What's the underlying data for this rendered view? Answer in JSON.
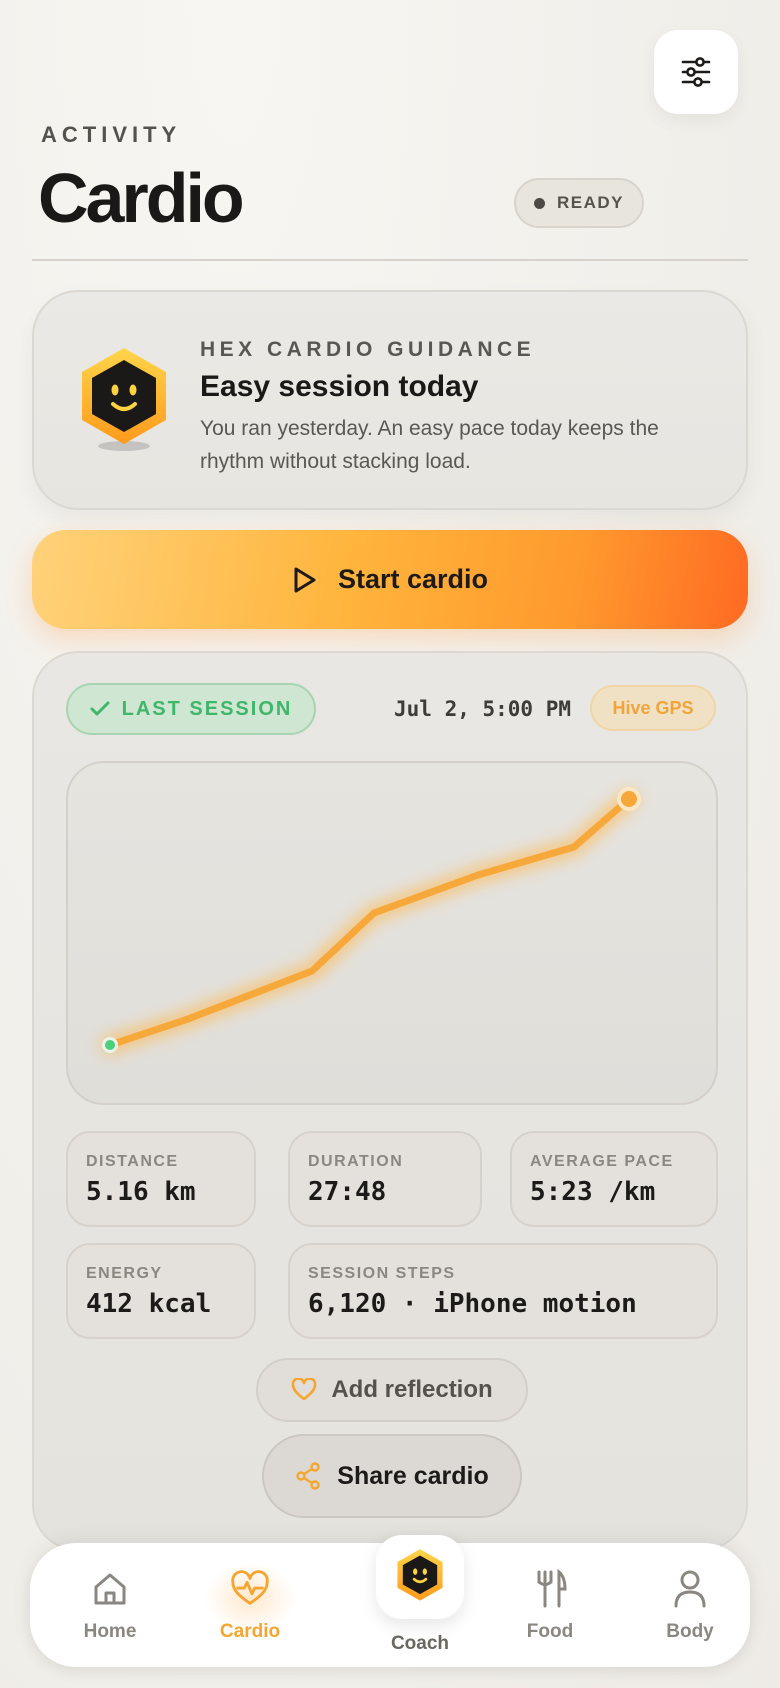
{
  "header": {
    "eyebrow": "ACTIVITY",
    "title": "Cardio",
    "status": "READY",
    "settings_icon": "sliders-icon"
  },
  "guidance": {
    "eyebrow": "HEX CARDIO GUIDANCE",
    "title": "Easy session today",
    "body": "You ran yesterday. An easy pace today keeps the rhythm without stacking load."
  },
  "start_button": {
    "label": "Start cardio",
    "icon": "play-icon"
  },
  "last_session": {
    "badge": "LAST SESSION",
    "date": "Jul 2, 5:00 PM",
    "source": "Hive GPS",
    "stats": {
      "distance": {
        "label": "DISTANCE",
        "value": "5.16 km"
      },
      "duration": {
        "label": "DURATION",
        "value": "27:48"
      },
      "pace": {
        "label": "AVERAGE PACE",
        "value": "5:23 /km"
      },
      "energy": {
        "label": "ENERGY",
        "value": "412 kcal"
      },
      "steps": {
        "label": "SESSION STEPS",
        "value": "6,120 · iPhone motion"
      }
    },
    "reflection_label": "Add reflection",
    "share_label": "Share cardio"
  },
  "colors": {
    "accent": "#f5a530",
    "accent_deep": "#ff6a22",
    "success": "#3fb66a",
    "text": "#1c1b19"
  },
  "tabbar": {
    "home": "Home",
    "cardio": "Cardio",
    "coach": "Coach",
    "food": "Food",
    "body": "Body"
  }
}
